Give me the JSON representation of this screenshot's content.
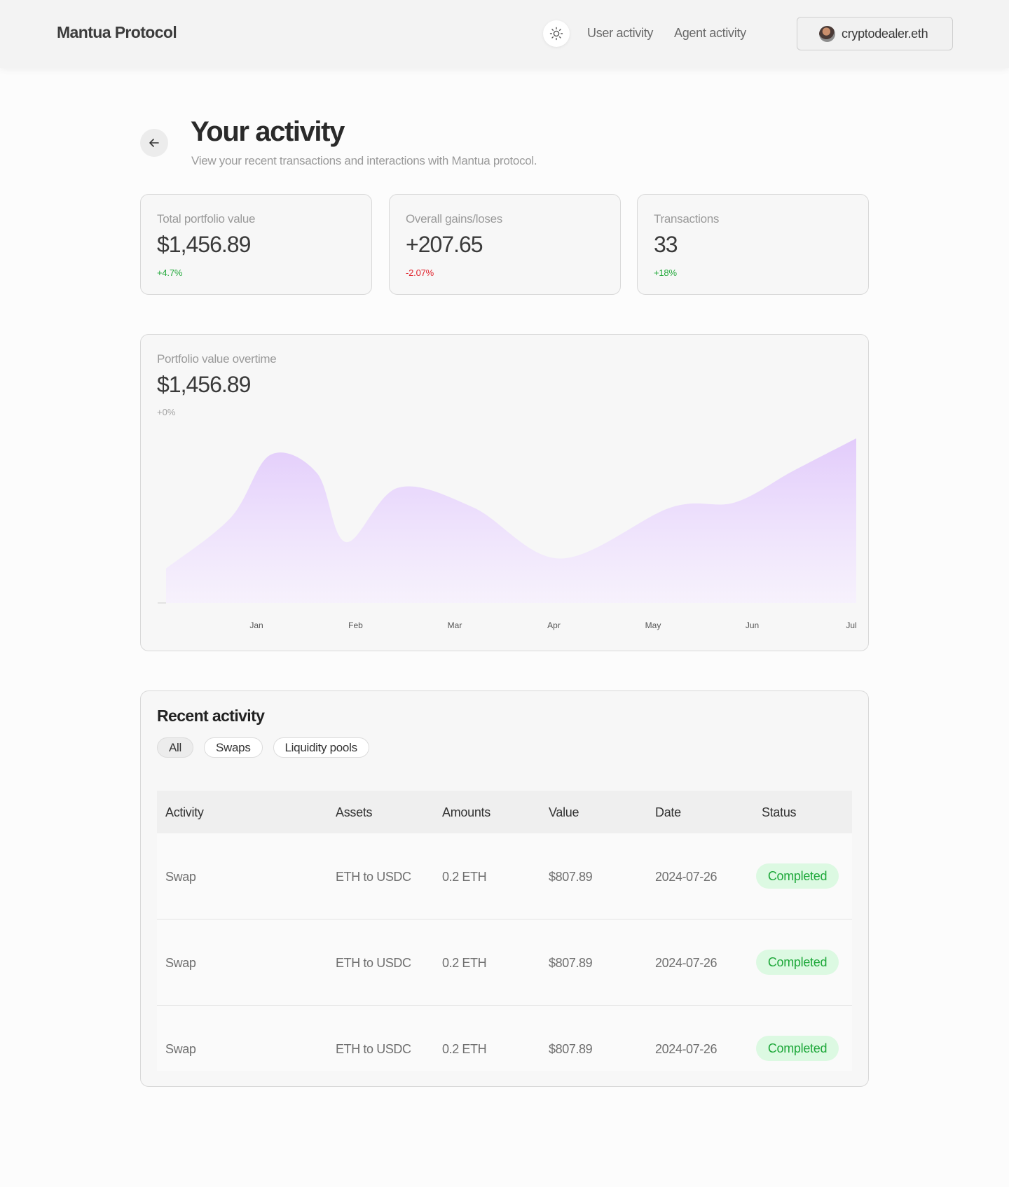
{
  "header": {
    "brand": "Mantua Protocol",
    "theme_icon": "sun-icon",
    "nav": [
      {
        "label": "User activity"
      },
      {
        "label": "Agent activity"
      }
    ],
    "wallet": {
      "name": "cryptodealer.eth",
      "avatar_icon": "avatar"
    }
  },
  "page": {
    "back_icon": "arrow-left-icon",
    "title": "Your activity",
    "subtitle": "View your recent transactions and interactions with Mantua protocol."
  },
  "stats": [
    {
      "label": "Total portfolio value",
      "value": "$1,456.89",
      "delta": "+4.7%",
      "trend": "up"
    },
    {
      "label": "Overall gains/loses",
      "value": "+207.65",
      "delta": "-2.07%",
      "trend": "down"
    },
    {
      "label": "Transactions",
      "value": "33",
      "delta": "+18%",
      "trend": "up"
    }
  ],
  "portfolio_chart": {
    "label": "Portfolio value overtime",
    "value": "$1,456.89",
    "delta": "+0%"
  },
  "chart_data": {
    "type": "area",
    "x": [
      "Jan",
      "Feb",
      "Mar",
      "Apr",
      "May",
      "Jun",
      "Jul"
    ],
    "fill_color": "#e3ccfb",
    "points": [
      {
        "x": 0.0,
        "y": 0.21
      },
      {
        "x": 0.56,
        "y": 0.52
      },
      {
        "x": 0.9,
        "y": 0.9
      },
      {
        "x": 1.3,
        "y": 0.79
      },
      {
        "x": 1.55,
        "y": 0.37
      },
      {
        "x": 2.0,
        "y": 0.7
      },
      {
        "x": 2.65,
        "y": 0.58
      },
      {
        "x": 3.4,
        "y": 0.27
      },
      {
        "x": 4.35,
        "y": 0.58
      },
      {
        "x": 4.9,
        "y": 0.61
      },
      {
        "x": 5.4,
        "y": 0.8
      },
      {
        "x": 5.95,
        "y": 1.0
      }
    ]
  },
  "activity": {
    "title": "Recent activity",
    "filters": [
      {
        "label": "All",
        "active": true
      },
      {
        "label": "Swaps",
        "active": false
      },
      {
        "label": "Liquidity pools",
        "active": false
      }
    ],
    "columns": [
      "Activity",
      "Assets",
      "Amounts",
      "Value",
      "Date",
      "Status"
    ],
    "rows": [
      {
        "activity": "Swap",
        "assets": "ETH to USDC",
        "amount": "0.2 ETH",
        "value": "$807.89",
        "date": "2024-07-26",
        "status": "Completed"
      },
      {
        "activity": "Swap",
        "assets": "ETH to USDC",
        "amount": "0.2 ETH",
        "value": "$807.89",
        "date": "2024-07-26",
        "status": "Completed"
      },
      {
        "activity": "Swap",
        "assets": "ETH to USDC",
        "amount": "0.2 ETH",
        "value": "$807.89",
        "date": "2024-07-26",
        "status": "Completed"
      }
    ]
  }
}
